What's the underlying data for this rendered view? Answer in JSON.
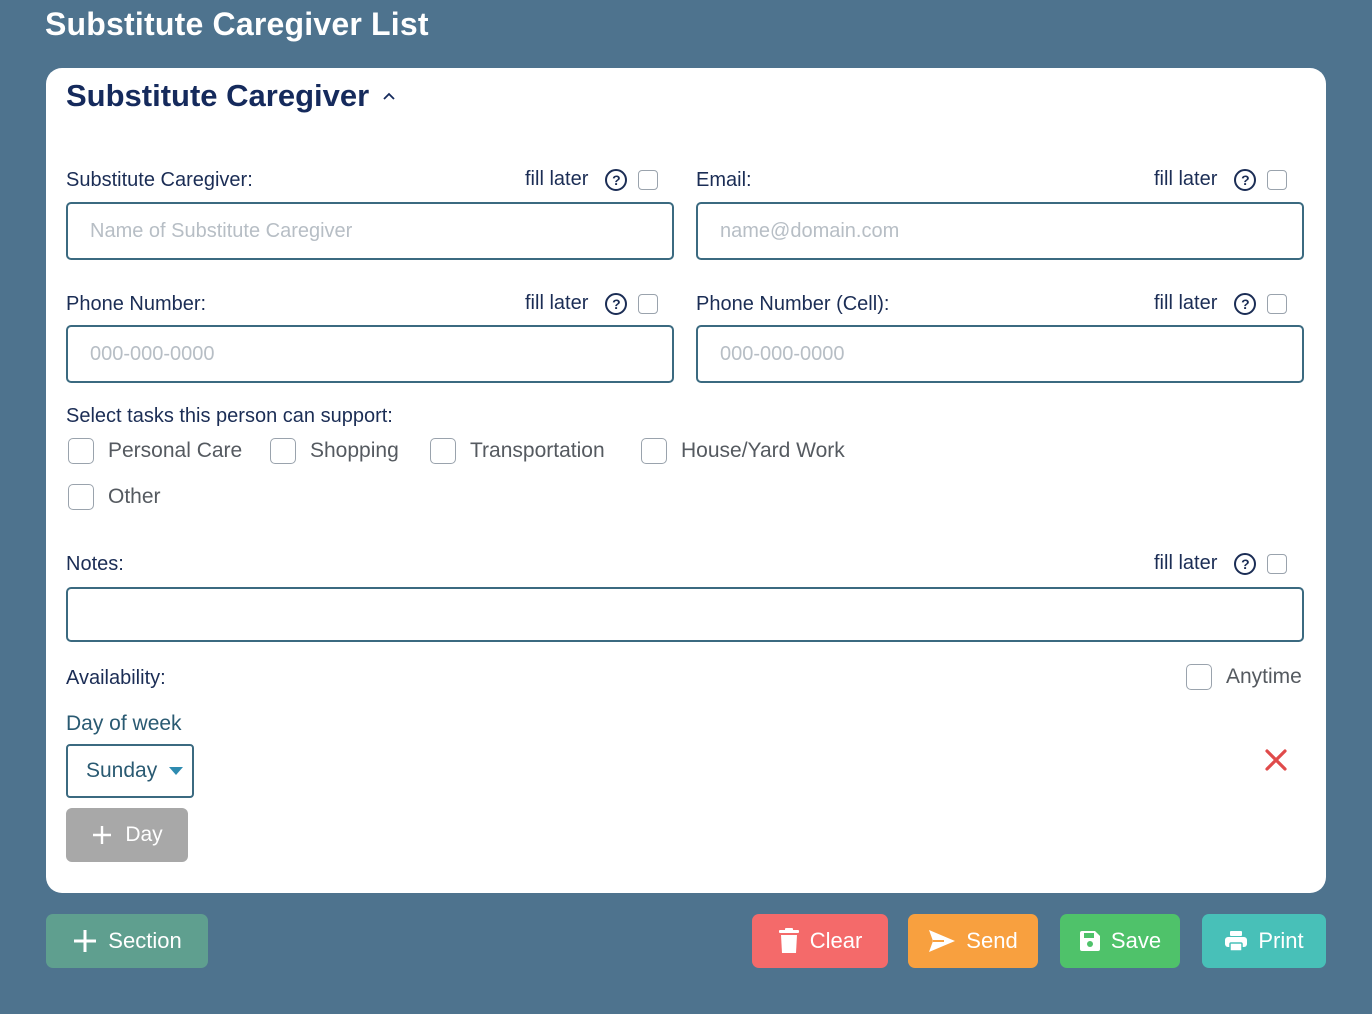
{
  "page": {
    "title": "Substitute Caregiver List"
  },
  "section": {
    "title": "Substitute Caregiver",
    "fields": {
      "caregiver": {
        "label": "Substitute Caregiver:",
        "placeholder": "Name of Substitute Caregiver",
        "value": ""
      },
      "email": {
        "label": "Email:",
        "placeholder": "name@domain.com",
        "value": ""
      },
      "phone": {
        "label": "Phone Number:",
        "placeholder": "000-000-0000",
        "value": ""
      },
      "cell": {
        "label": "Phone Number (Cell):",
        "placeholder": "000-000-0000",
        "value": ""
      },
      "notes": {
        "label": "Notes:",
        "placeholder": "",
        "value": ""
      }
    },
    "fill_later": "fill later",
    "help_glyph": "?",
    "tasks": {
      "label": "Select tasks this person can support:",
      "items": [
        "Personal Care",
        "Shopping",
        "Transportation",
        "House/Yard Work",
        "Other"
      ]
    },
    "availability": {
      "label": "Availability:",
      "anytime_label": "Anytime",
      "day_of_week_label": "Day of week",
      "selected_day": "Sunday",
      "add_day_label": "Day"
    }
  },
  "footer": {
    "add_section_label": "Section",
    "clear_label": "Clear",
    "send_label": "Send",
    "save_label": "Save",
    "print_label": "Print"
  },
  "colors": {
    "background": "#4e738e",
    "section_button": "#5f9f8f",
    "clear": "#f46a6a",
    "send": "#f8a03f",
    "save": "#4fc26a",
    "print": "#48c0b8",
    "remove": "#e04b4b"
  },
  "icons": [
    "chevron-up-icon",
    "help-icon",
    "plus-icon",
    "trash-icon",
    "send-icon",
    "save-icon",
    "print-icon",
    "close-icon"
  ]
}
